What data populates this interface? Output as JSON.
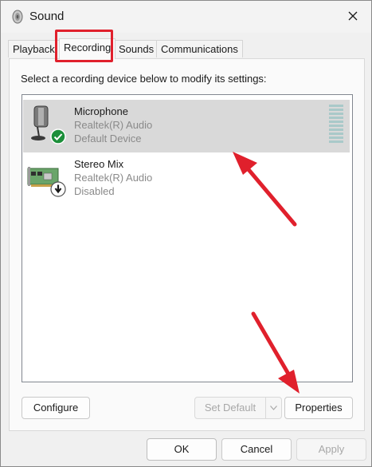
{
  "window": {
    "title": "Sound",
    "title_icon": "speaker-icon",
    "close_icon": "close-icon"
  },
  "tabs": [
    {
      "label": "Playback",
      "active": false
    },
    {
      "label": "Recording",
      "active": true
    },
    {
      "label": "Sounds",
      "active": false
    },
    {
      "label": "Communications",
      "active": false
    }
  ],
  "panel": {
    "instruction": "Select a recording device below to modify its settings:"
  },
  "devices": [
    {
      "name": "Microphone",
      "driver": "Realtek(R) Audio",
      "status": "Default Device",
      "selected": true,
      "icon": "microphone-icon",
      "badge": "check-badge-icon"
    },
    {
      "name": "Stereo Mix",
      "driver": "Realtek(R) Audio",
      "status": "Disabled",
      "selected": false,
      "icon": "sound-card-icon",
      "badge": "disabled-arrow-badge-icon"
    }
  ],
  "panel_buttons": {
    "configure": "Configure",
    "set_default": "Set Default",
    "properties": "Properties"
  },
  "dialog_buttons": {
    "ok": "OK",
    "cancel": "Cancel",
    "apply": "Apply"
  },
  "colors": {
    "annotation_red": "#e0202c",
    "selected_row": "#d9d9d9",
    "check_green": "#1c8f3a"
  }
}
